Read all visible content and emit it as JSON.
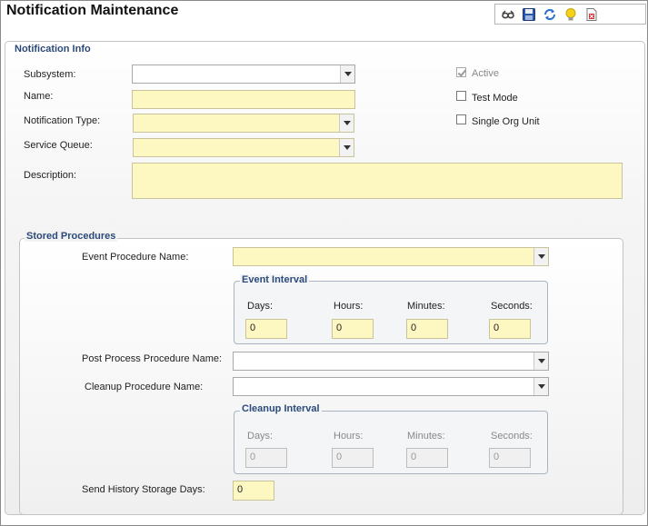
{
  "title": "Notification Maintenance",
  "toolbar": {
    "icons": [
      "view-icon",
      "save-icon",
      "refresh-icon",
      "lightbulb-icon",
      "delete-icon"
    ]
  },
  "notification_info": {
    "legend": "Notification Info",
    "subsystem_label": "Subsystem:",
    "subsystem_value": "",
    "name_label": "Name:",
    "name_value": "",
    "type_label": "Notification Type:",
    "type_value": "",
    "queue_label": "Service Queue:",
    "queue_value": "",
    "description_label": "Description:",
    "description_value": "",
    "active_label": "Active",
    "active_checked": true,
    "test_mode_label": "Test Mode",
    "test_mode_checked": false,
    "single_org_label": "Single Org Unit",
    "single_org_checked": false
  },
  "stored_procedures": {
    "legend": "Stored Procedures",
    "event_proc_label": "Event Procedure Name:",
    "event_proc_value": "",
    "event_interval": {
      "legend": "Event Interval",
      "days_label": "Days:",
      "hours_label": "Hours:",
      "minutes_label": "Minutes:",
      "seconds_label": "Seconds:",
      "days": "0",
      "hours": "0",
      "minutes": "0",
      "seconds": "0"
    },
    "post_proc_label": "Post Process Procedure Name:",
    "post_proc_value": "",
    "cleanup_proc_label": "Cleanup Procedure Name:",
    "cleanup_proc_value": "",
    "cleanup_interval": {
      "legend": "Cleanup Interval",
      "days_label": "Days:",
      "hours_label": "Hours:",
      "minutes_label": "Minutes:",
      "seconds_label": "Seconds:",
      "days": "0",
      "hours": "0",
      "minutes": "0",
      "seconds": "0"
    },
    "history_days_label": "Send History Storage Days:",
    "history_days_value": "0"
  }
}
